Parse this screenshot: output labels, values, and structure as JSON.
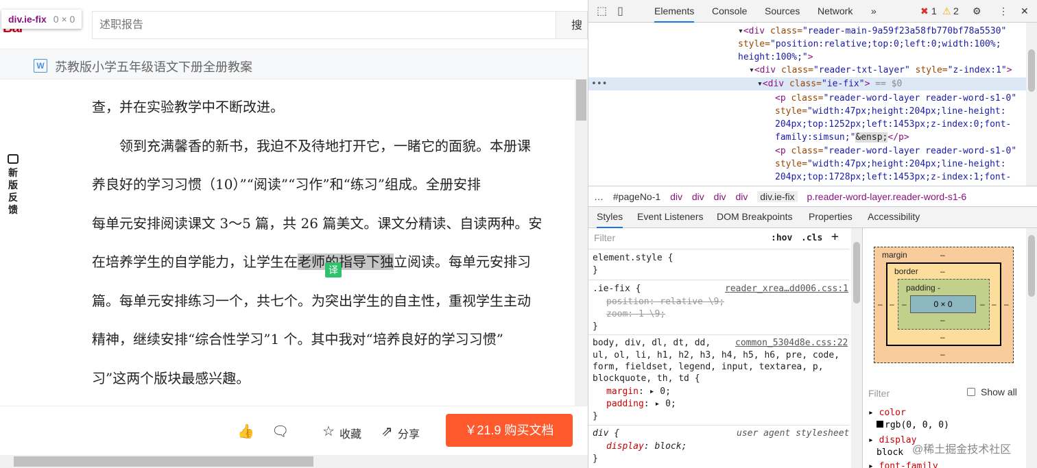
{
  "page": {
    "tooltip": {
      "tag": "div.ie-fix",
      "dims": "0 × 0"
    },
    "logo": "Bai",
    "search": {
      "placeholder": "述职报告",
      "button": "搜"
    },
    "doc": {
      "icon": "W",
      "title": "苏教版小学五年级语文下册全册教案"
    },
    "feedback": [
      "新",
      "版",
      "反",
      "馈"
    ],
    "content": {
      "line1": "查，并在实验教学中不断改进。",
      "line2": "　　领到充满馨香的新书，我迫不及待地打开它，一睹它的面貌。本册课",
      "line3": "养良好的学习习惯（10）”“阅读”“习作”和“练习”组成。全册安排",
      "line4": "每单元安排阅读课文 3～5 篇，共 26 篇美文。课文分精读、自读两种。安",
      "line5a": "在培养学生的自学能力，让学生在",
      "line5b": "老师的指导下独",
      "line5c": "立阅读。每单元安排习",
      "line6": "篇。每单元安排练习一个，共七个。为突出学生的自主性，重视学生主动",
      "line7": "精神，继续安排“综合性学习”1 个。其中我对“培养良好的学习习惯”",
      "line8": "习”这两个版块最感兴趣。"
    },
    "translate_badge": "译",
    "actions": {
      "collect": "收藏",
      "share": "分享",
      "buy": "￥21.9 购买文档"
    }
  },
  "devtools": {
    "tabs": [
      "Elements",
      "Console",
      "Sources",
      "Network"
    ],
    "errors": "1",
    "warnings": "2",
    "dom": {
      "l1_tag": "<div",
      "l1_attr": " class=",
      "l1_val": "\"reader-main-9a59f23a58fb770bf78a5530\"",
      "l2_attr": "style=",
      "l2_val": "\"position:relative;top:0;left:0;width:100%;",
      "l3_val": "height:100%;\"",
      "l3_tag": ">",
      "l4_tag": "<div",
      "l4_attr": " class=",
      "l4_val": "\"reader-txt-layer\"",
      "l4_attr2": " style=",
      "l4_val2": "\"z-index:1\"",
      "l4_end": ">",
      "l5_tag": "<div",
      "l5_attr": " class=",
      "l5_val": "\"ie-fix\"",
      "l5_end": ">",
      "l5_eq": " == $0",
      "l6_tag": "<p",
      "l6_attr": " class=",
      "l6_val": "\"reader-word-layer reader-word-s1-0\"",
      "l7_attr": "style=",
      "l7_val": "\"width:47px;height:204px;line-height:",
      "l8_val": "204px;top:1252px;left:1453px;z-index:0;font-",
      "l9_val": "family:simsun;\"",
      "l9_ent": "&ensp;",
      "l9_close": "</p>",
      "l10_tag": "<p",
      "l10_attr": " class=",
      "l10_val": "\"reader-word-layer reader-word-s1-0\"",
      "l11_attr": "style=",
      "l11_val": "\"width:47px;height:204px;line-height:",
      "l12_val": "204px;top:1728px;left:1453px;z-index:1;font-"
    },
    "breadcrumbs": [
      "#pageNo-1",
      "div",
      "div",
      "div",
      "div",
      "div.ie-fix",
      "p.reader-word-layer.reader-word-s1-6"
    ],
    "subtabs": [
      "Styles",
      "Event Listeners",
      "DOM Breakpoints",
      "Properties",
      "Accessibility"
    ],
    "styles": {
      "filter": "Filter",
      "hov": ":hov",
      "cls": ".cls",
      "element_style": "element.style {",
      "close": "}",
      "iefix_sel": ".ie-fix {",
      "iefix_src": "reader_xrea…dd006.css:1",
      "iefix_p1": "position: relative \\9;",
      "iefix_p2": "zoom: 1 \\9;",
      "body_sel1": "body, div, dl, dt, dd,",
      "body_src": "common_5304d8e.css:22",
      "body_sel2": "ul, ol, li, h1, h2, h3, h4, h5, h6, pre, code,",
      "body_sel3": "form, fieldset, legend, input, textarea, p,",
      "body_sel4": "blockquote, th, td {",
      "margin_name": "margin",
      "margin_val": "0;",
      "padding_name": "padding",
      "padding_val": "0;",
      "div_sel": "div {",
      "div_src": "user agent stylesheet",
      "display_name": "display",
      "display_val": "block;"
    },
    "boxmodel": {
      "margin": "margin",
      "border": "border",
      "padding": "padding -",
      "content": "0 × 0",
      "dash": "–"
    },
    "computed": {
      "filter": "Filter",
      "show_all": "Show all",
      "color_name": "color",
      "color_val": "rgb(0, 0, 0)",
      "display_name": "display",
      "display_val": "block",
      "font_name": "font-family"
    },
    "watermark": "@稀土掘金技术社区"
  }
}
